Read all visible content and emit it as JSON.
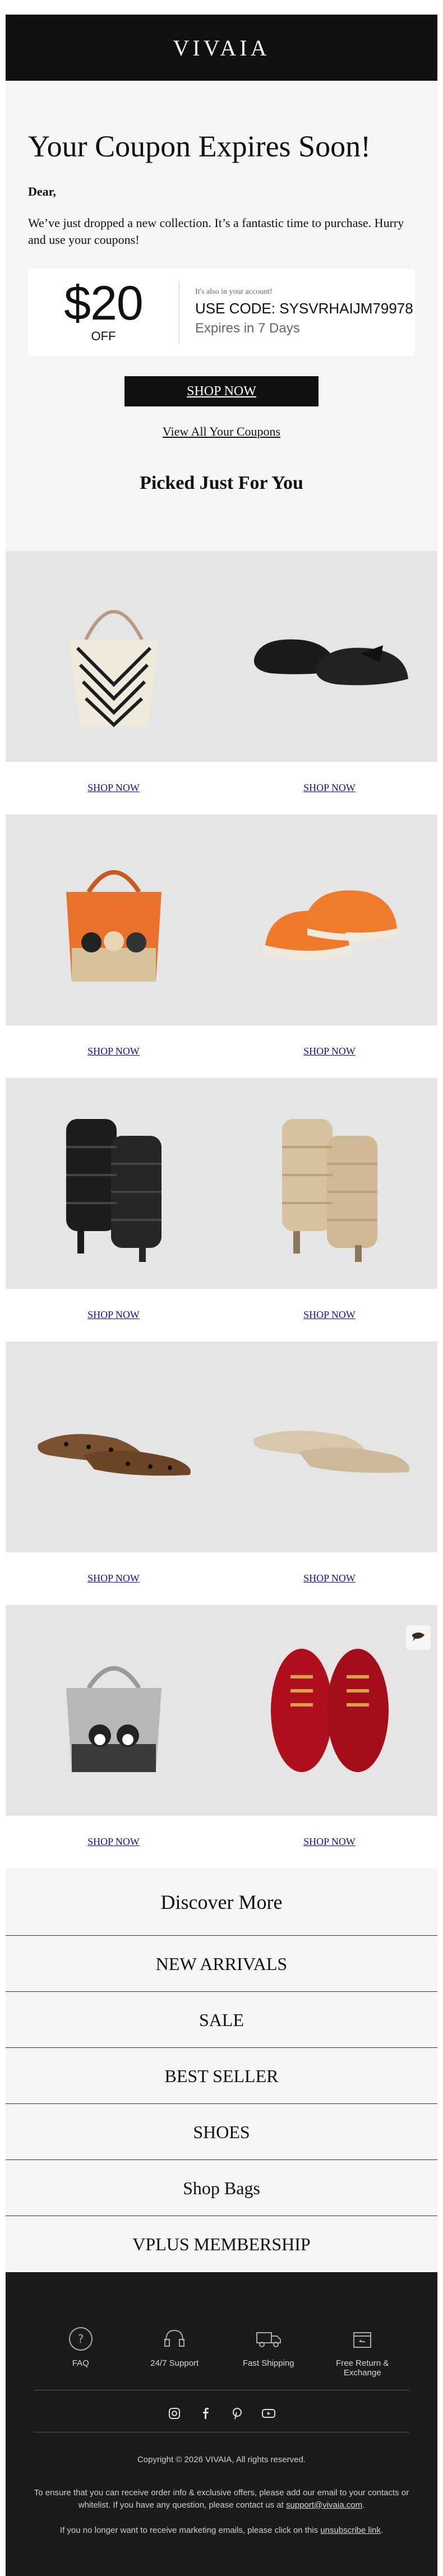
{
  "header": {
    "logo": "VIVAIA"
  },
  "coupon_section": {
    "headline": "Your Coupon Expires Soon!",
    "greeting": "Dear,",
    "intro": "We’ve just dropped a new collection. It’s a fantastic time to purchase. Hurry and use your coupons!",
    "coupon": {
      "amount": "$20",
      "off": "OFF",
      "note": "It's also in your account!",
      "code": "USE CODE: SYSVRHAIJM79978",
      "expires": "Expires in 7 Days"
    },
    "shop_now": "SHOP NOW",
    "view_all": "View All Your Coupons"
  },
  "picks": {
    "title": "Picked Just For You",
    "link_label": "SHOP NOW",
    "rows": [
      {
        "left": "chevron-tote-bag",
        "right": "black-knit-bow-flats"
      },
      {
        "left": "orange-cat-tote-bag",
        "right": "orange-knit-sneakers"
      },
      {
        "left": "black-quilted-leg-warmers",
        "right": "beige-quilted-leg-warmers"
      },
      {
        "left": "leopard-pointed-flats",
        "right": "beige-pointed-flats"
      },
      {
        "left": "grey-dog-tote-bag",
        "right": "red-lace-up-sneakers"
      }
    ]
  },
  "discover": {
    "title": "Discover More",
    "items": [
      "NEW ARRIVALS",
      "SALE",
      "BEST SELLER",
      "SHOES",
      "Shop Bags",
      "VPLUS MEMBERSHIP"
    ]
  },
  "footer": {
    "services": [
      {
        "label": "FAQ",
        "icon": "question-icon"
      },
      {
        "label": "24/7 Support",
        "icon": "headset-icon"
      },
      {
        "label": "Fast Shipping",
        "icon": "truck-icon"
      },
      {
        "label": "Free Return & Exchange",
        "icon": "return-box-icon"
      }
    ],
    "social": [
      "instagram-icon",
      "facebook-icon",
      "pinterest-icon",
      "youtube-icon"
    ],
    "copyright": "Copyright © 2026 VIVAIA, All rights reserved.",
    "info_text": "To ensure that you can receive order info & exclusive offers, please add our email to your contacts or whitelist. If you have any question, please contact us at",
    "support_email": "support@vivaia.com",
    "unsubscribe_text": "If you no longer want to receive marketing emails, please click on this",
    "unsubscribe_link": "unsubscribe link"
  },
  "colors": {
    "dark": "#111111",
    "panel": "#f5f5f4",
    "product_bg": "#e5e5e5",
    "link": "#1a0dab",
    "accent_orange": "#e8712b",
    "accent_red": "#b0101e"
  }
}
